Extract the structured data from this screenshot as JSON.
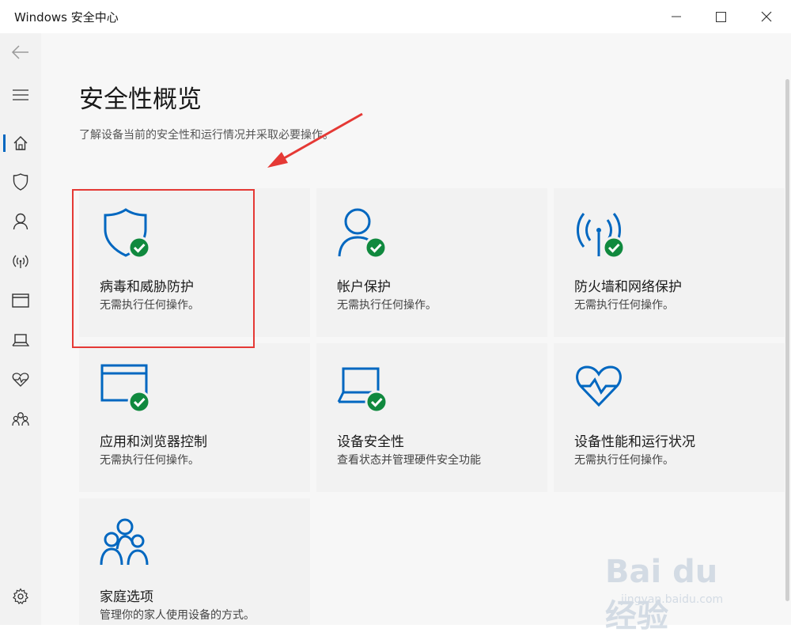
{
  "window": {
    "title": "Windows 安全中心"
  },
  "colors": {
    "accent": "#0067c0",
    "ok": "#10893e",
    "annotation": "#e53935"
  },
  "sidebar": {
    "items": [
      {
        "name": "back",
        "icon": "back-arrow-icon"
      },
      {
        "name": "menu",
        "icon": "hamburger-icon"
      },
      {
        "name": "home",
        "icon": "home-icon",
        "active": true
      },
      {
        "name": "virus",
        "icon": "shield-icon"
      },
      {
        "name": "account",
        "icon": "person-icon"
      },
      {
        "name": "firewall",
        "icon": "antenna-icon"
      },
      {
        "name": "app-browser",
        "icon": "window-icon"
      },
      {
        "name": "device-security",
        "icon": "laptop-icon"
      },
      {
        "name": "device-health",
        "icon": "heart-icon"
      },
      {
        "name": "family",
        "icon": "family-icon"
      },
      {
        "name": "settings",
        "icon": "gear-icon"
      }
    ]
  },
  "main": {
    "title": "安全性概览",
    "subtitle": "了解设备当前的安全性和运行情况并采取必要操作。",
    "cards": [
      {
        "title": "病毒和威胁防护",
        "desc": "无需执行任何操作。",
        "icon": "shield-icon"
      },
      {
        "title": "帐户保护",
        "desc": "无需执行任何操作。",
        "icon": "person-icon"
      },
      {
        "title": "防火墙和网络保护",
        "desc": "无需执行任何操作。",
        "icon": "antenna-icon"
      },
      {
        "title": "应用和浏览器控制",
        "desc": "无需执行任何操作。",
        "icon": "window-icon"
      },
      {
        "title": "设备安全性",
        "desc": "查看状态并管理硬件安全功能",
        "icon": "laptop-icon"
      },
      {
        "title": "设备性能和运行状况",
        "desc": "无需执行任何操作。",
        "icon": "heart-icon"
      },
      {
        "title": "家庭选项",
        "desc": "管理你的家人使用设备的方式。",
        "icon": "family-icon"
      }
    ]
  },
  "watermark": {
    "brand": "Bai du 经验",
    "url": "jingyan.baidu.com"
  }
}
